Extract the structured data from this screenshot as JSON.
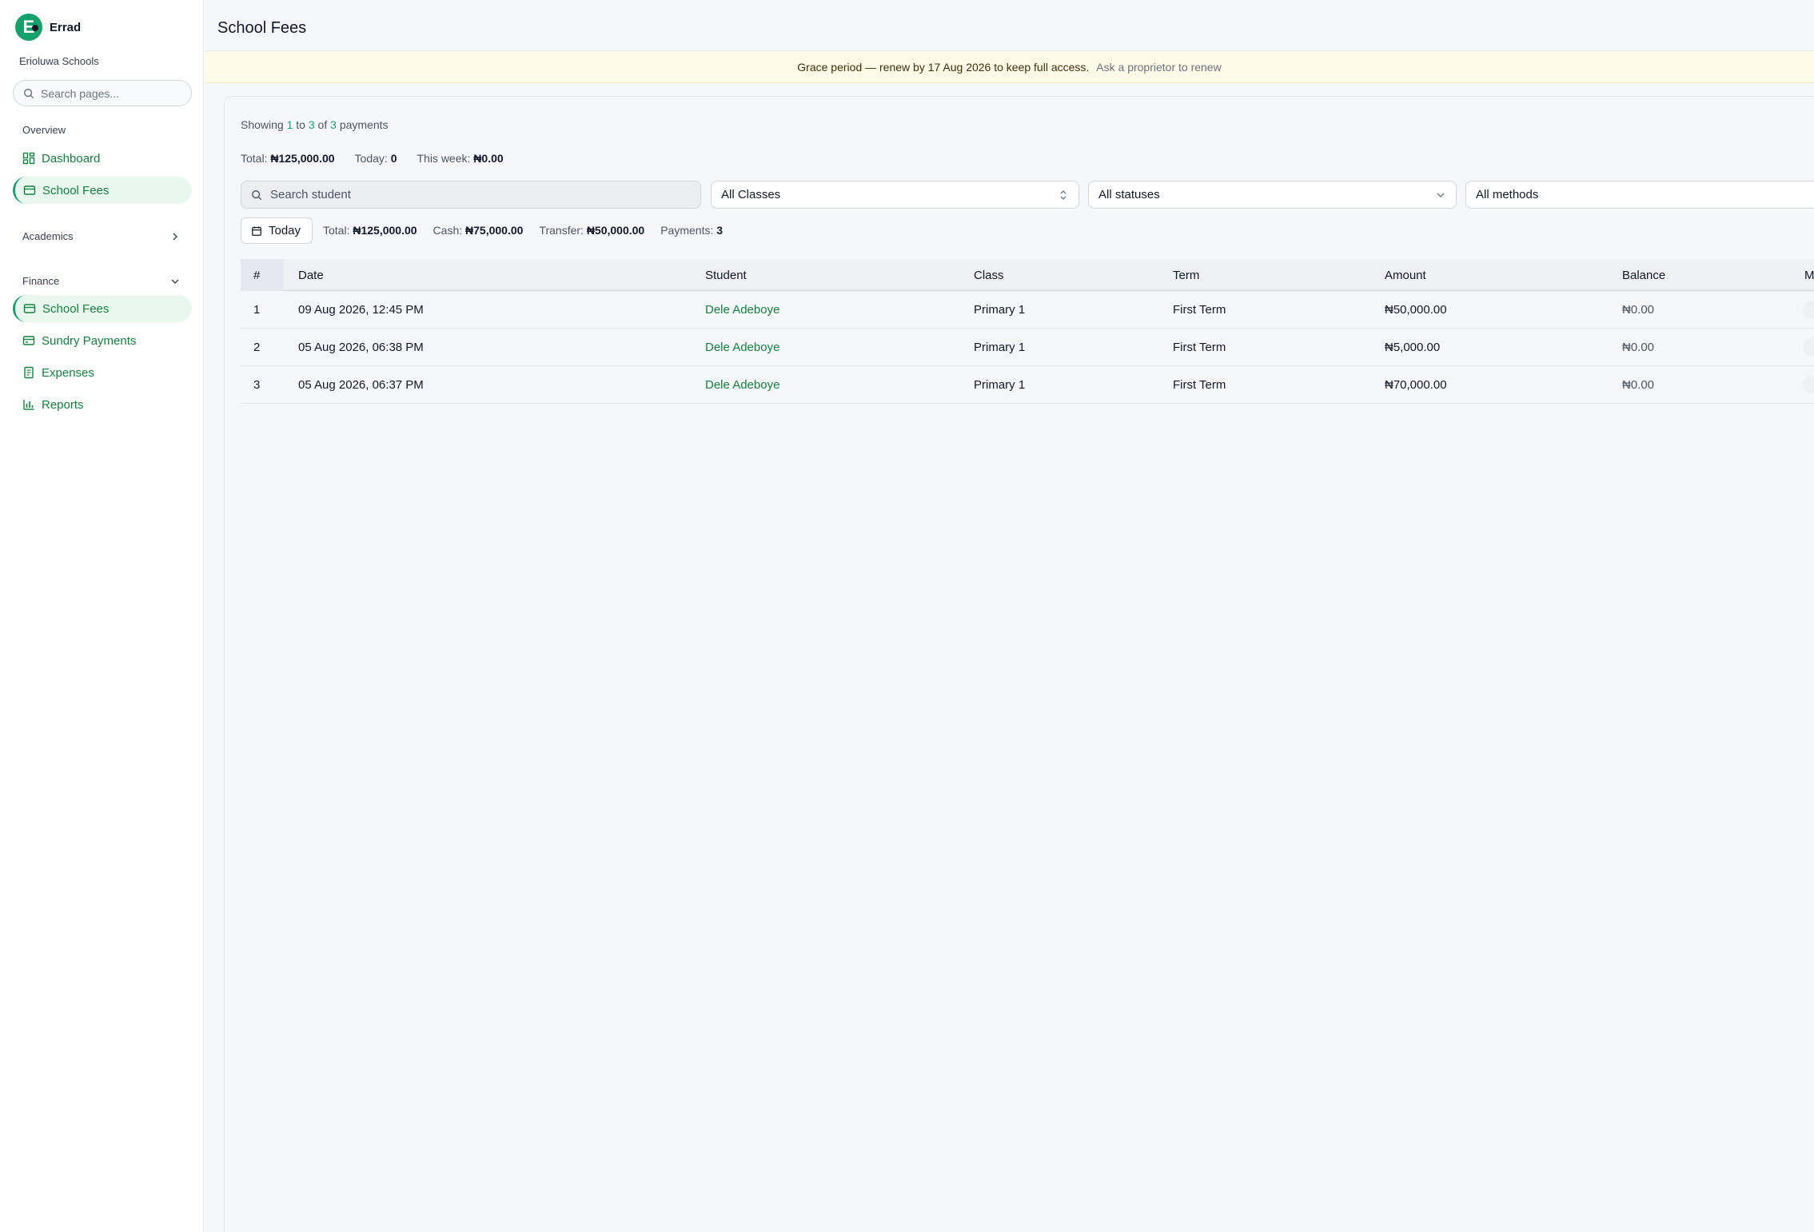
{
  "brand": {
    "logo_letter": "E",
    "name": "Errad"
  },
  "sidebar": {
    "school_name": "Erioluwa Schools",
    "search_placeholder": "Search pages...",
    "sections": {
      "overview": "Overview",
      "academics": "Academics",
      "finance": "Finance"
    },
    "overview_items": [
      {
        "label": "Dashboard",
        "icon": "dashboard-icon"
      },
      {
        "label": "School Fees",
        "icon": "credit-card-icon",
        "active": true
      }
    ],
    "finance_items": [
      {
        "label": "School Fees",
        "icon": "credit-card-icon",
        "active": true
      },
      {
        "label": "Sundry Payments",
        "icon": "wallet-icon"
      },
      {
        "label": "Expenses",
        "icon": "receipt-icon"
      },
      {
        "label": "Reports",
        "icon": "bar-chart-icon"
      }
    ]
  },
  "header": {
    "title": "School Fees"
  },
  "banner": {
    "message": "Grace period — renew by 17 Aug 2026 to keep full access.",
    "link": "Ask a proprietor to renew"
  },
  "summary": {
    "showing_prefix": "Showing",
    "from": "1",
    "to_word": "to",
    "to": "3",
    "of_word": "of",
    "total_count": "3",
    "suffix": "payments",
    "total_label": "Total:",
    "total_value": "₦125,000.00",
    "today_label": "Today:",
    "today_value": "0",
    "week_label": "This week:",
    "week_value": "₦0.00"
  },
  "filters": {
    "search_placeholder": "Search student",
    "class_select": "All Classes",
    "status_select": "All statuses",
    "method_select": "All methods"
  },
  "today_bar": {
    "button_label": "Today",
    "total_label": "Total:",
    "total_value": "₦125,000.00",
    "cash_label": "Cash:",
    "cash_value": "₦75,000.00",
    "transfer_label": "Transfer:",
    "transfer_value": "₦50,000.00",
    "payments_label": "Payments:",
    "payments_value": "3"
  },
  "table": {
    "columns": [
      "#",
      "Date",
      "Student",
      "Class",
      "Term",
      "Amount",
      "Balance",
      "M"
    ],
    "rows": [
      {
        "num": "1",
        "date": "09 Aug 2026, 12:45 PM",
        "student": "Dele Adeboye",
        "class": "Primary 1",
        "term": "First Term",
        "amount": "₦50,000.00",
        "balance": "₦0.00"
      },
      {
        "num": "2",
        "date": "05 Aug 2026, 06:38 PM",
        "student": "Dele Adeboye",
        "class": "Primary 1",
        "term": "First Term",
        "amount": "₦5,000.00",
        "balance": "₦0.00"
      },
      {
        "num": "3",
        "date": "05 Aug 2026, 06:37 PM",
        "student": "Dele Adeboye",
        "class": "Primary 1",
        "term": "First Term",
        "amount": "₦70,000.00",
        "balance": "₦0.00"
      }
    ]
  },
  "colors": {
    "accent": "#16a06c",
    "link": "#15803d",
    "banner_bg": "#fefbe8"
  }
}
